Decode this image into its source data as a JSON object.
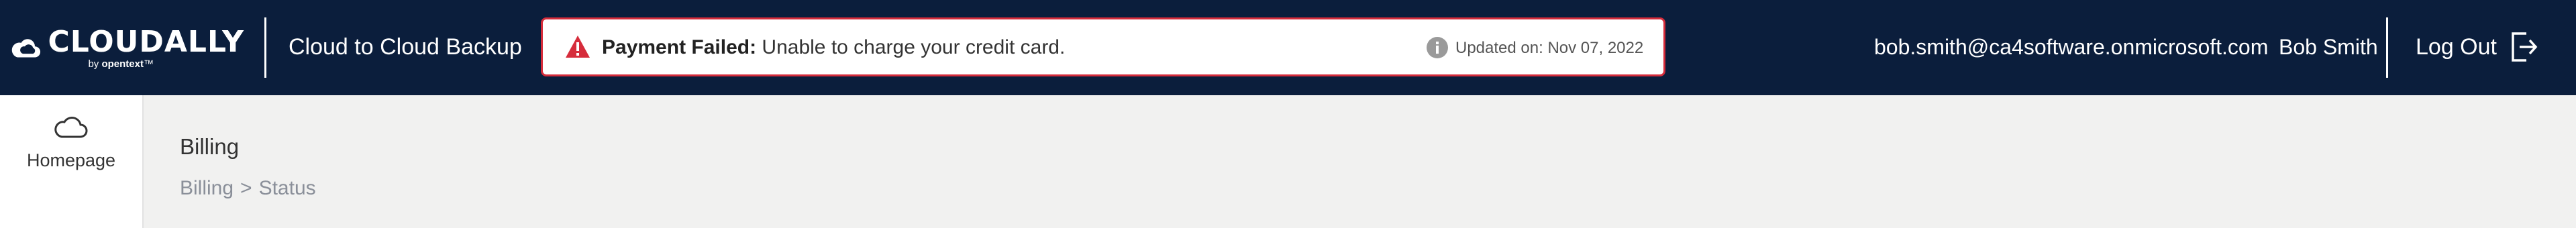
{
  "header": {
    "logo": {
      "name": "CLOUDALLY",
      "sub_prefix": "by",
      "sub_brand": "opentext",
      "sub_mark": "™",
      "icon": "cloud-logo-icon"
    },
    "product_title": "Cloud to Cloud Backup",
    "alert": {
      "icon": "warning-triangle-icon",
      "title": "Payment Failed:",
      "message": "Unable to charge your credit card.",
      "info_icon": "info-circle-icon",
      "updated_label": "Updated on:",
      "updated_date": "Nov 07, 2022",
      "border_color": "#d62c3b"
    },
    "user_email": "bob.smith@ca4software.onmicrosoft.com",
    "user_name": "Bob Smith",
    "logout_label": "Log Out",
    "logout_icon": "logout-icon",
    "background_color": "#0b1e3c"
  },
  "sidebar": {
    "items": [
      {
        "label": "Homepage",
        "icon": "cloud-outline-icon"
      }
    ]
  },
  "main": {
    "title": "Billing",
    "breadcrumb": [
      "Billing",
      "Status"
    ],
    "breadcrumb_separator": ">"
  }
}
